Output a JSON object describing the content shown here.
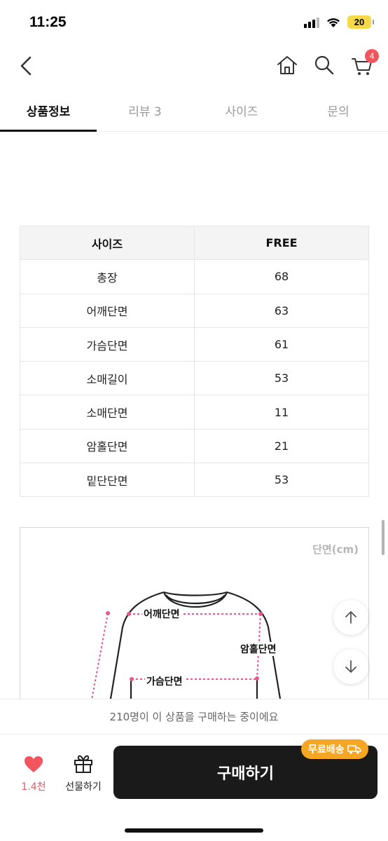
{
  "status_bar": {
    "time": "11:25",
    "battery": "20"
  },
  "nav": {
    "cart_count": "4"
  },
  "tabs": [
    {
      "label": "상품정보",
      "active": true
    },
    {
      "label": "리뷰 3",
      "active": false
    },
    {
      "label": "사이즈",
      "active": false
    },
    {
      "label": "문의",
      "active": false
    }
  ],
  "size_table": {
    "headers": [
      "사이즈",
      "FREE"
    ],
    "rows": [
      [
        "총장",
        "68"
      ],
      [
        "어깨단면",
        "63"
      ],
      [
        "가슴단면",
        "61"
      ],
      [
        "소매길이",
        "53"
      ],
      [
        "소매단면",
        "11"
      ],
      [
        "암홀단면",
        "21"
      ],
      [
        "밑단단면",
        "53"
      ]
    ]
  },
  "diagram": {
    "unit": "단면(cm)",
    "labels": {
      "shoulder": "어깨단면",
      "armhole": "암홀단면",
      "chest": "가슴단면"
    }
  },
  "bottom": {
    "buyers_note": "210명이 이 상품을 구매하는 중이에요",
    "like_count": "1.4천",
    "gift_label": "선물하기",
    "buy_label": "구매하기",
    "shipping_badge": "무료배송"
  },
  "colors": {
    "accent": "#f2555e",
    "badge": "#f5a623",
    "buy_button": "#1a1a1a"
  }
}
